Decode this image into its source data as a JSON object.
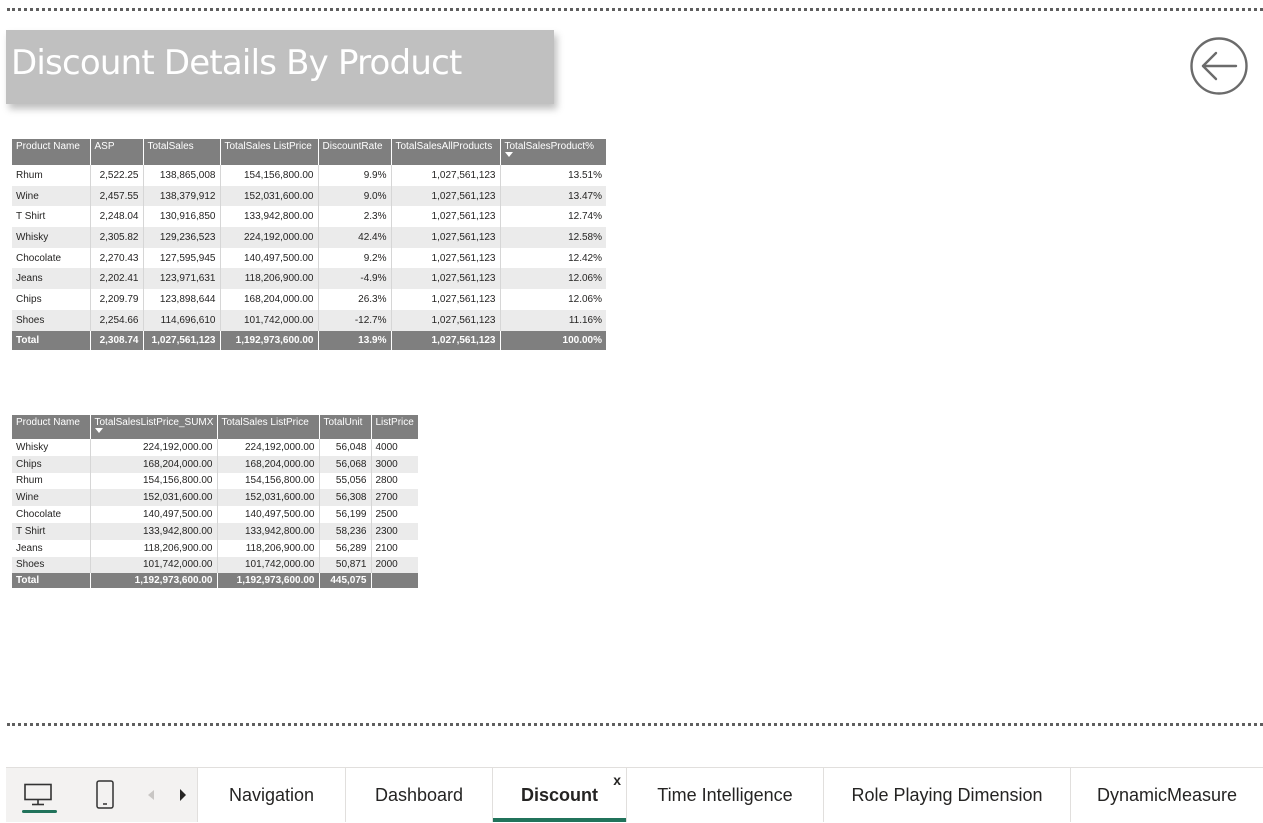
{
  "page": {
    "title": "Discount Details By Product",
    "colors": {
      "header_gray": "#7f7f7f",
      "title_bg": "#c0c0c0",
      "accent": "#21735b",
      "alt_row": "#ebebeb"
    }
  },
  "back_button": {
    "icon": "arrow-left-circle-icon"
  },
  "table1": {
    "headers": [
      "Product Name",
      "ASP",
      "TotalSales",
      "TotalSales ListPrice",
      "DiscountRate",
      "TotalSalesAllProducts",
      "TotalSalesProduct%"
    ],
    "sorted_column": "TotalSalesProduct%",
    "rows": [
      [
        "Rhum",
        "2,522.25",
        "138,865,008",
        "154,156,800.00",
        "9.9%",
        "1,027,561,123",
        "13.51%"
      ],
      [
        "Wine",
        "2,457.55",
        "138,379,912",
        "152,031,600.00",
        "9.0%",
        "1,027,561,123",
        "13.47%"
      ],
      [
        "T Shirt",
        "2,248.04",
        "130,916,850",
        "133,942,800.00",
        "2.3%",
        "1,027,561,123",
        "12.74%"
      ],
      [
        "Whisky",
        "2,305.82",
        "129,236,523",
        "224,192,000.00",
        "42.4%",
        "1,027,561,123",
        "12.58%"
      ],
      [
        "Chocolate",
        "2,270.43",
        "127,595,945",
        "140,497,500.00",
        "9.2%",
        "1,027,561,123",
        "12.42%"
      ],
      [
        "Jeans",
        "2,202.41",
        "123,971,631",
        "118,206,900.00",
        "-4.9%",
        "1,027,561,123",
        "12.06%"
      ],
      [
        "Chips",
        "2,209.79",
        "123,898,644",
        "168,204,000.00",
        "26.3%",
        "1,027,561,123",
        "12.06%"
      ],
      [
        "Shoes",
        "2,254.66",
        "114,696,610",
        "101,742,000.00",
        "-12.7%",
        "1,027,561,123",
        "11.16%"
      ]
    ],
    "total": [
      "Total",
      "2,308.74",
      "1,027,561,123",
      "1,192,973,600.00",
      "13.9%",
      "1,027,561,123",
      "100.00%"
    ]
  },
  "table2": {
    "headers": [
      "Product Name",
      "TotalSalesListPrice_SUMX",
      "TotalSales ListPrice",
      "TotalUnit",
      "ListPrice"
    ],
    "sorted_column": "TotalSalesListPrice_SUMX",
    "rows": [
      [
        "Whisky",
        "224,192,000.00",
        "224,192,000.00",
        "56,048",
        "4000"
      ],
      [
        "Chips",
        "168,204,000.00",
        "168,204,000.00",
        "56,068",
        "3000"
      ],
      [
        "Rhum",
        "154,156,800.00",
        "154,156,800.00",
        "55,056",
        "2800"
      ],
      [
        "Wine",
        "152,031,600.00",
        "152,031,600.00",
        "56,308",
        "2700"
      ],
      [
        "Chocolate",
        "140,497,500.00",
        "140,497,500.00",
        "56,199",
        "2500"
      ],
      [
        "T Shirt",
        "133,942,800.00",
        "133,942,800.00",
        "58,236",
        "2300"
      ],
      [
        "Jeans",
        "118,206,900.00",
        "118,206,900.00",
        "56,289",
        "2100"
      ],
      [
        "Shoes",
        "101,742,000.00",
        "101,742,000.00",
        "50,871",
        "2000"
      ]
    ],
    "total": [
      "Total",
      "1,192,973,600.00",
      "1,192,973,600.00",
      "445,075",
      ""
    ]
  },
  "bottom_bar": {
    "views": [
      {
        "name": "desktop-view",
        "icon": "desktop-monitor-icon",
        "active": true
      },
      {
        "name": "mobile-view",
        "icon": "mobile-phone-icon",
        "active": false
      }
    ],
    "prev_icon": "chevron-left-icon",
    "next_icon": "chevron-right-icon",
    "tabs": [
      {
        "label": "Navigation",
        "active": false
      },
      {
        "label": "Dashboard",
        "active": false
      },
      {
        "label": "Discount",
        "active": true,
        "close": "x"
      },
      {
        "label": "Time Intelligence",
        "active": false
      },
      {
        "label": "Role Playing Dimension",
        "active": false
      },
      {
        "label": "DynamicMeasure",
        "active": false
      }
    ]
  }
}
